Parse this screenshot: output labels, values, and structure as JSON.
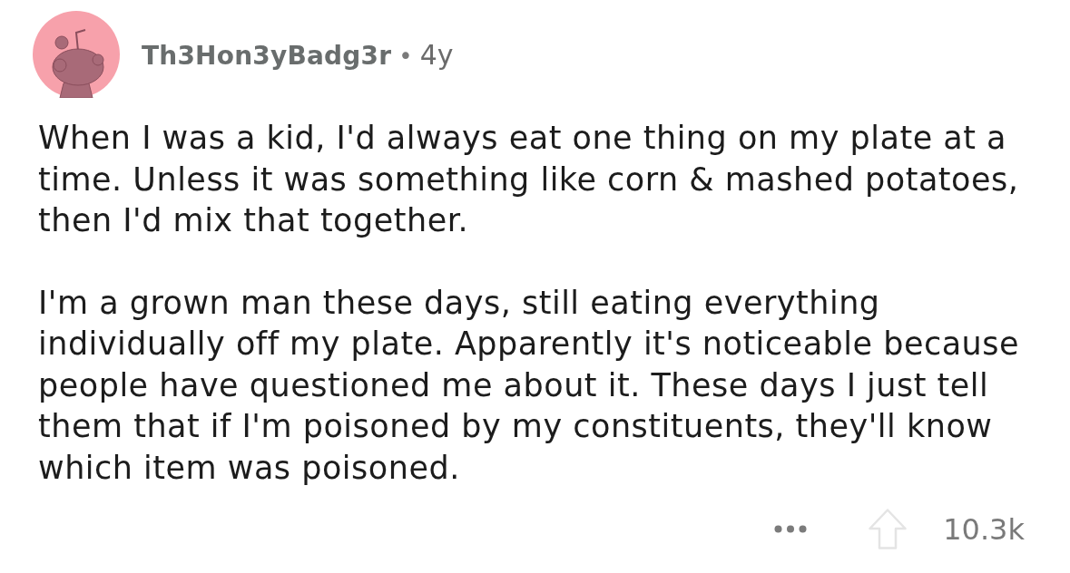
{
  "comment": {
    "author": "Th3Hon3yBadg3r",
    "separator": "•",
    "age": "4y",
    "paragraphs": [
      "When I was a kid, I'd always eat one thing on my plate at a time. Unless it was something like corn & mashed potatoes, then I'd mix that together.",
      "I'm a grown man these days, still eating everything individually off my plate. Apparently it's noticeable because people have questioned me about it. These days I just tell them that if I'm poisoned by my constituents, they'll know which item was poisoned."
    ],
    "score": "10.3k"
  }
}
